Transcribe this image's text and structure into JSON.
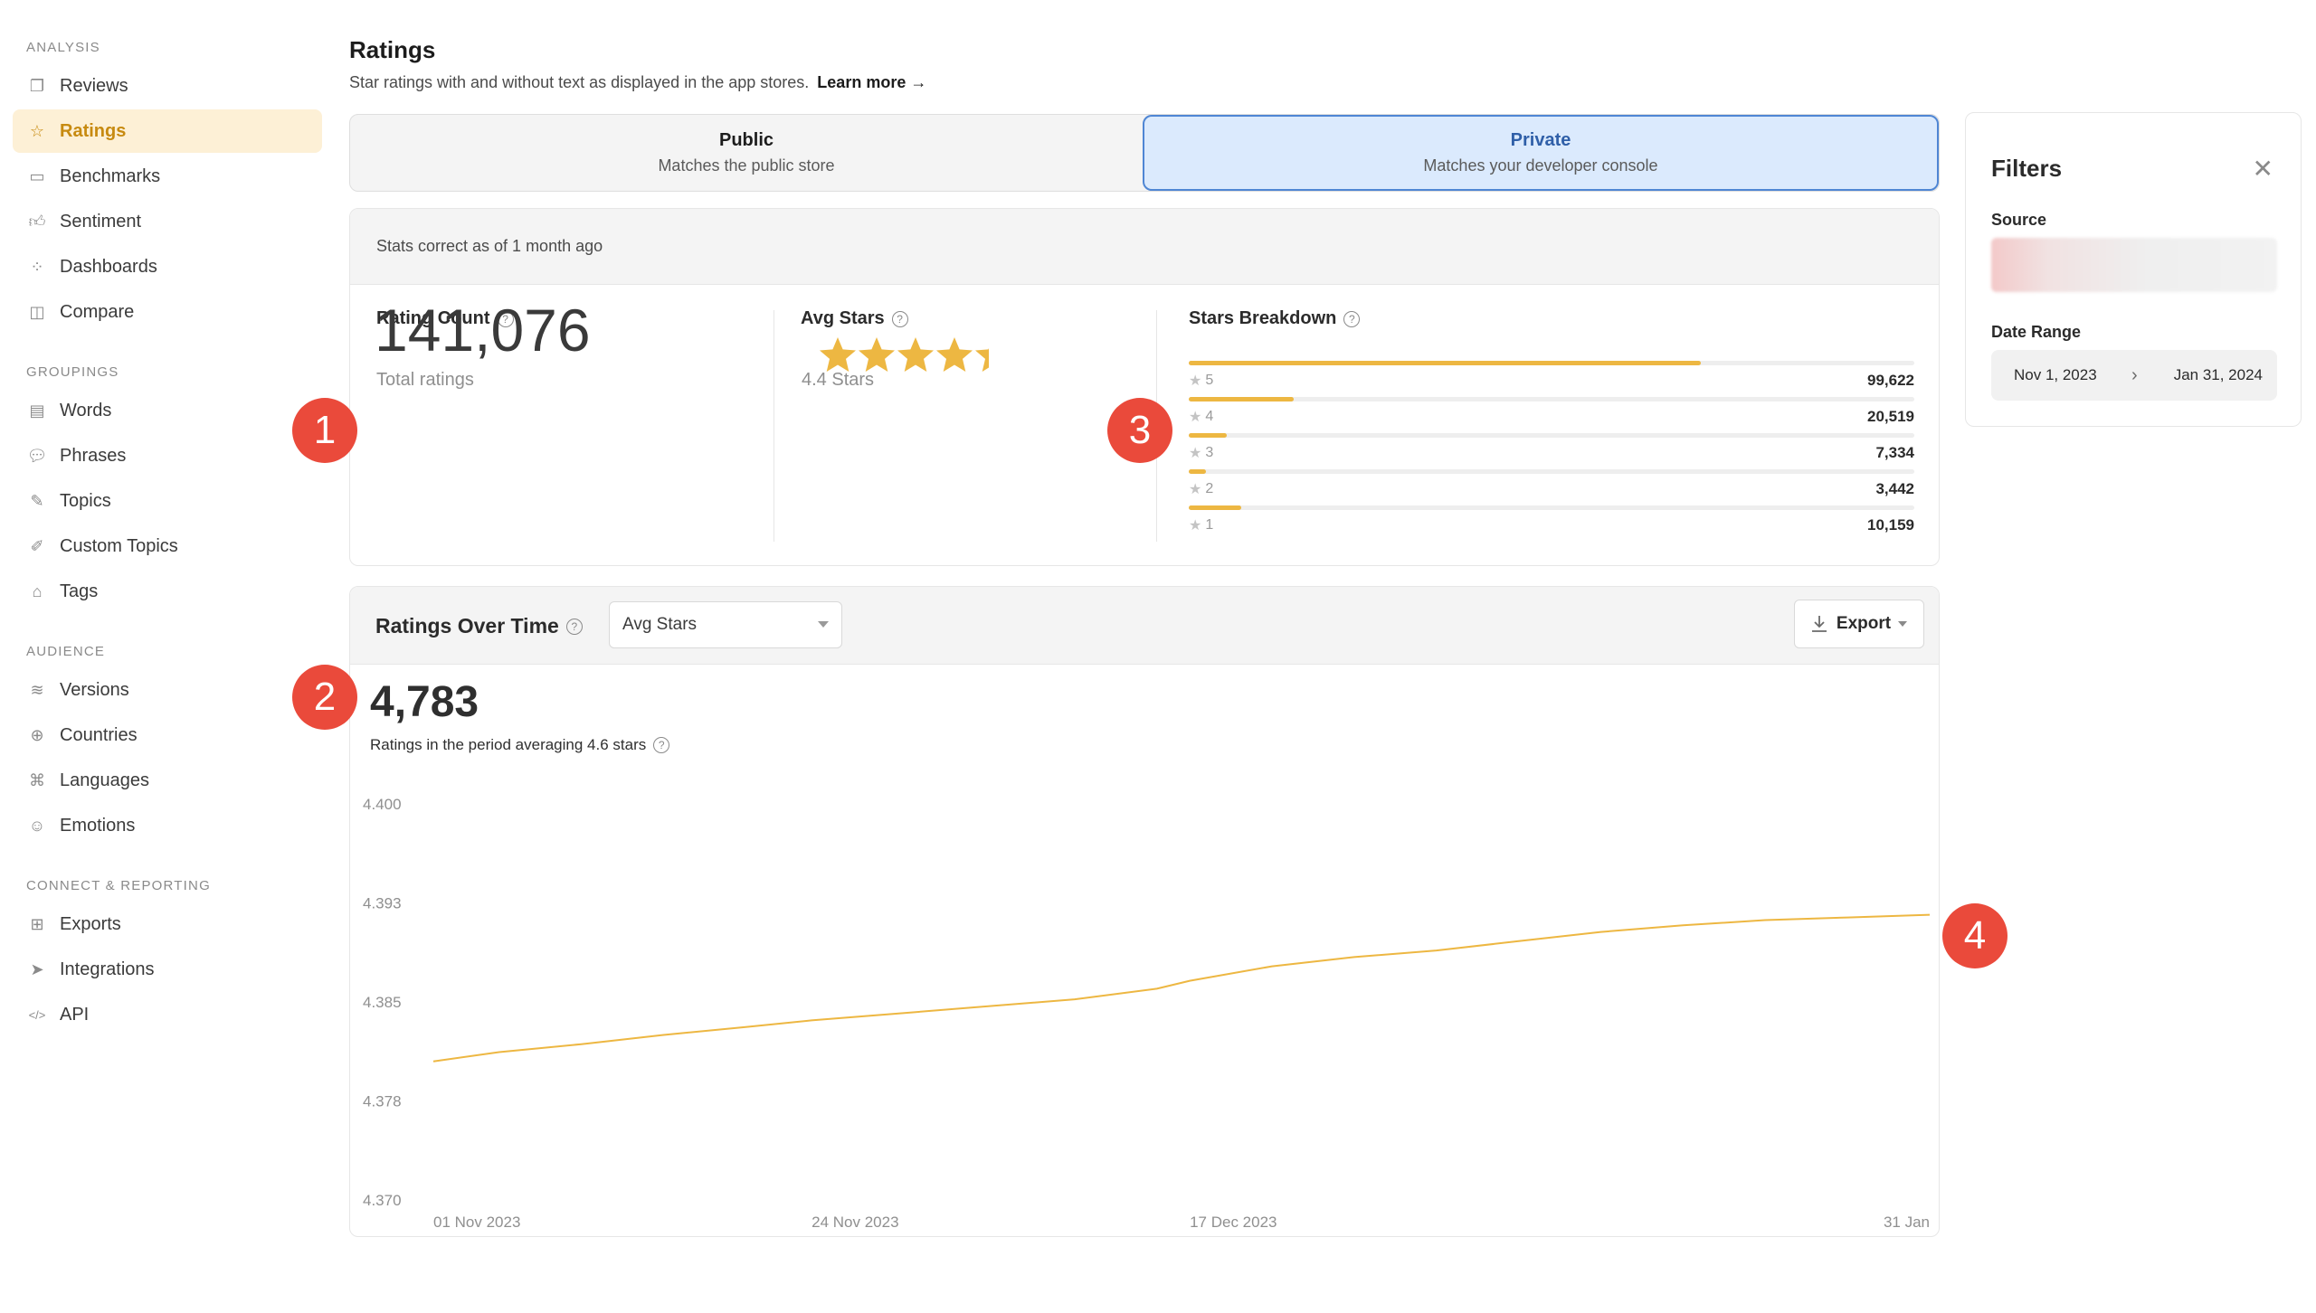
{
  "sidebar": {
    "groups": [
      {
        "label": "ANALYSIS",
        "items": [
          {
            "label": "Reviews",
            "icon": "reviews-icon"
          },
          {
            "label": "Ratings",
            "icon": "star-icon",
            "active": true
          },
          {
            "label": "Benchmarks",
            "icon": "benchmarks-icon"
          },
          {
            "label": "Sentiment",
            "icon": "thumbs-up-icon"
          },
          {
            "label": "Dashboards",
            "icon": "dashboard-grid-icon"
          },
          {
            "label": "Compare",
            "icon": "compare-icon"
          }
        ]
      },
      {
        "label": "GROUPINGS",
        "items": [
          {
            "label": "Words",
            "icon": "words-icon"
          },
          {
            "label": "Phrases",
            "icon": "speech-bubble-icon"
          },
          {
            "label": "Topics",
            "icon": "pencil-icon"
          },
          {
            "label": "Custom Topics",
            "icon": "edit-square-icon"
          },
          {
            "label": "Tags",
            "icon": "tag-icon"
          }
        ]
      },
      {
        "label": "AUDIENCE",
        "items": [
          {
            "label": "Versions",
            "icon": "layers-icon"
          },
          {
            "label": "Countries",
            "icon": "globe-icon"
          },
          {
            "label": "Languages",
            "icon": "translate-icon"
          },
          {
            "label": "Emotions",
            "icon": "smiley-icon"
          }
        ]
      },
      {
        "label": "CONNECT & REPORTING",
        "items": [
          {
            "label": "Exports",
            "icon": "export-box-icon"
          },
          {
            "label": "Integrations",
            "icon": "send-icon"
          },
          {
            "label": "API",
            "icon": "code-icon"
          }
        ]
      }
    ]
  },
  "header": {
    "title": "Ratings",
    "subtitle": "Star ratings with and without text as displayed in the app stores.",
    "learn_more": "Learn more →"
  },
  "segments": [
    {
      "title": "Public",
      "subtitle": "Matches the public store",
      "active": false
    },
    {
      "title": "Private",
      "subtitle": "Matches your developer console",
      "active": true
    }
  ],
  "stats": {
    "note": "Stats correct as of 1 month ago",
    "rating_count": {
      "title": "Rating Count",
      "value": "141,076",
      "caption": "Total ratings"
    },
    "avg_stars": {
      "title": "Avg Stars",
      "value": 4.4,
      "caption": "4.4 Stars"
    },
    "breakdown": {
      "title": "Stars Breakdown",
      "rows": [
        {
          "star": "5",
          "value": "99,622",
          "fraction": 0.706
        },
        {
          "star": "4",
          "value": "20,519",
          "fraction": 0.145
        },
        {
          "star": "3",
          "value": "7,334",
          "fraction": 0.052
        },
        {
          "star": "2",
          "value": "3,442",
          "fraction": 0.024
        },
        {
          "star": "1",
          "value": "10,159",
          "fraction": 0.072
        }
      ]
    }
  },
  "chart_section": {
    "title": "Ratings Over Time",
    "metric_select": "Avg Stars",
    "export_label": "Export",
    "period_total": "4,783",
    "period_caption": "Ratings in the period averaging 4.6 stars"
  },
  "markers": [
    "1",
    "2",
    "3",
    "4"
  ],
  "chart_data": {
    "type": "line",
    "ylim": [
      4.37,
      4.4
    ],
    "yticks": [
      "4.400",
      "4.393",
      "4.385",
      "4.378",
      "4.370"
    ],
    "xticks": [
      "01 Nov 2023",
      "24 Nov 2023",
      "17 Dec 2023",
      "31 Jan"
    ],
    "color": "#edb742",
    "series": [
      {
        "x": [
          "2023-11-01",
          "2023-11-05",
          "2023-11-10",
          "2023-11-15",
          "2023-11-20",
          "2023-11-24",
          "2023-11-30",
          "2023-12-05",
          "2023-12-10",
          "2023-12-15",
          "2023-12-17",
          "2023-12-22",
          "2023-12-27",
          "2024-01-01",
          "2024-01-06",
          "2024-01-11",
          "2024-01-16",
          "2024-01-21",
          "2024-01-26",
          "2024-01-31"
        ],
        "y": [
          4.3805,
          4.3812,
          4.3818,
          4.3825,
          4.3831,
          4.3836,
          4.3842,
          4.3847,
          4.3852,
          4.386,
          4.3866,
          4.3877,
          4.3884,
          4.3889,
          4.3896,
          4.3903,
          4.3908,
          4.3912,
          4.3914,
          4.3916
        ]
      }
    ]
  },
  "filters": {
    "title": "Filters",
    "source_label": "Source",
    "date_range_label": "Date Range",
    "date_from": "Nov 1, 2023",
    "date_to": "Jan 31, 2024"
  }
}
